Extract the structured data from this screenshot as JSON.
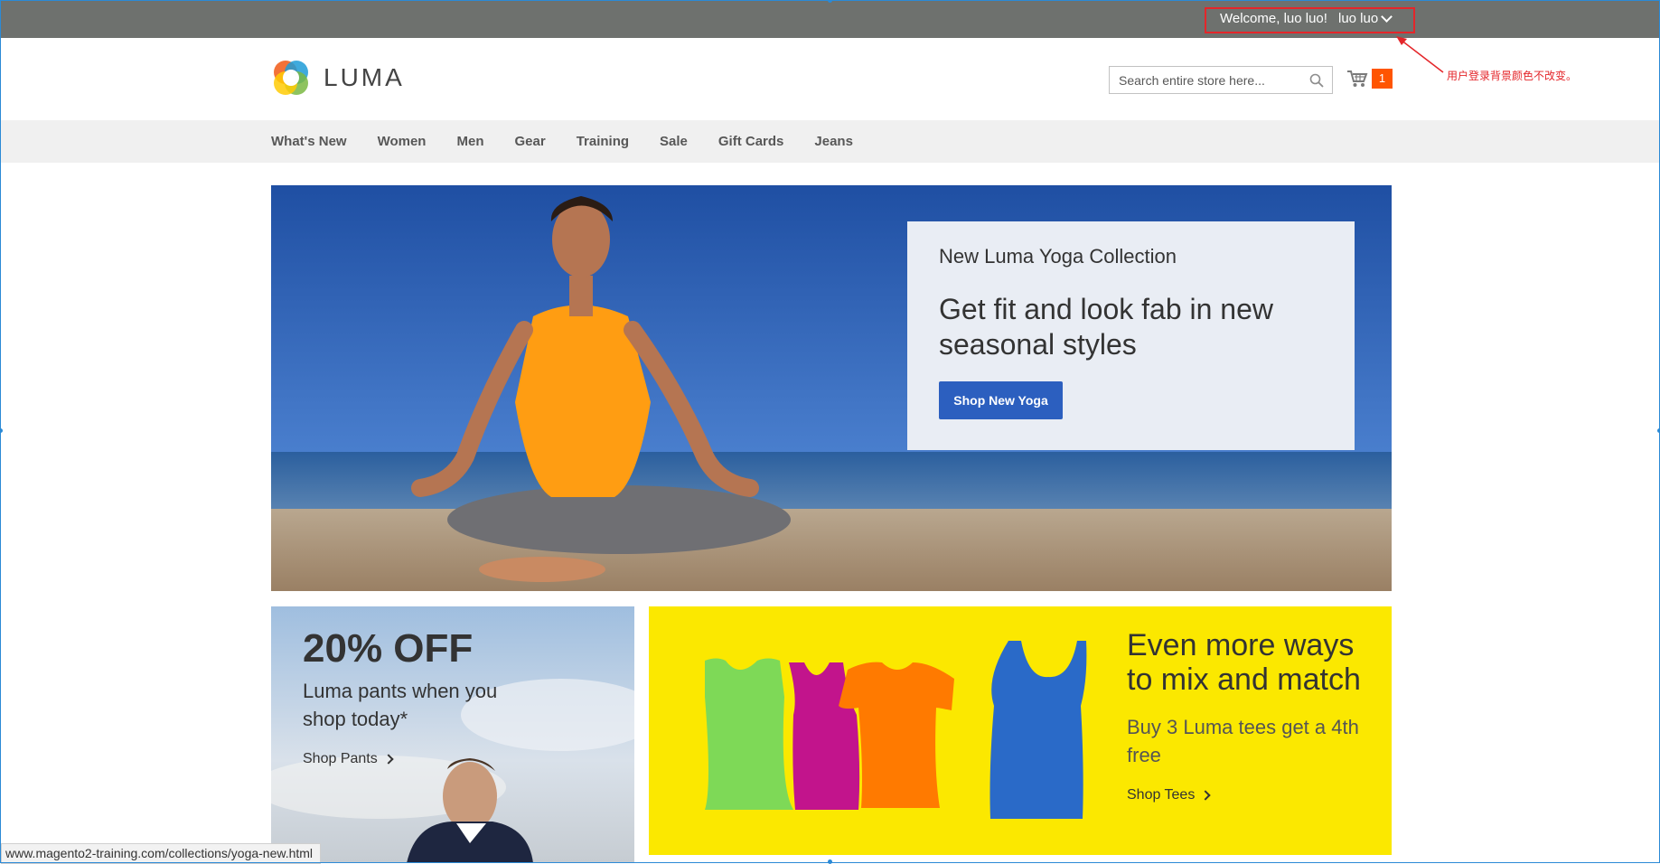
{
  "top_bar": {
    "welcome": "Welcome, luo luo!",
    "user_menu": "luo luo",
    "background_color": "#6e716e"
  },
  "annotation": {
    "note": "用户登录背景颜色不改变。",
    "color": "#e4262a"
  },
  "header": {
    "logo_text": "LUMA",
    "search": {
      "placeholder": "Search entire store here..."
    },
    "cart": {
      "count": "1",
      "icon": "cart-icon"
    }
  },
  "nav": {
    "items": [
      "What's New",
      "Women",
      "Men",
      "Gear",
      "Training",
      "Sale",
      "Gift Cards",
      "Jeans"
    ]
  },
  "hero": {
    "kicker": "New Luma Yoga Collection",
    "title": "Get fit and look fab in new seasonal styles",
    "button": "Shop New Yoga"
  },
  "promo_pants": {
    "title": "20% OFF",
    "subtitle": "Luma pants when you shop today*",
    "link": "Shop Pants"
  },
  "promo_tees": {
    "title": "Even more ways to mix and match",
    "subtitle": "Buy 3 Luma tees get a 4th free",
    "link": "Shop Tees"
  },
  "status_bar": {
    "url": "www.magento2-training.com/collections/yoga-new.html"
  }
}
